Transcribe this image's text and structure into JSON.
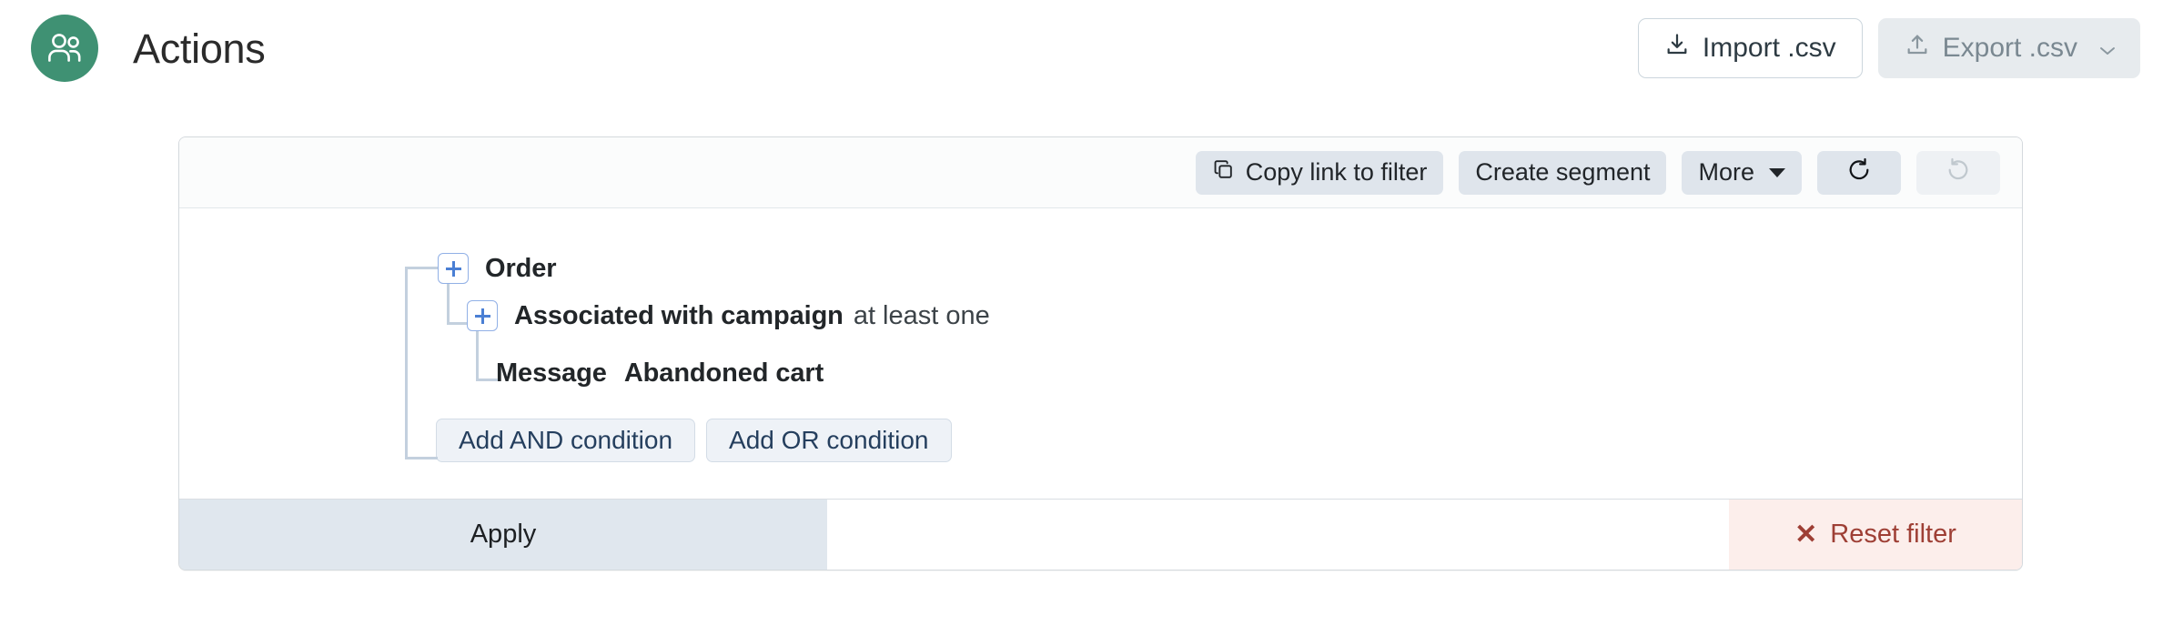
{
  "header": {
    "avatar_icon": "users-icon",
    "title": "Actions",
    "import_button": {
      "label": "Import .csv",
      "icon": "download-icon"
    },
    "export_button": {
      "label": "Export .csv",
      "icon": "upload-icon",
      "caret_icon": "chevron-down-icon",
      "disabled": true
    }
  },
  "filter_panel": {
    "toolbar": {
      "copy_link": {
        "label": "Copy link to filter",
        "icon": "copy-icon"
      },
      "create_segment": {
        "label": "Create segment"
      },
      "more": {
        "label": "More",
        "icon": "caret-down-icon"
      },
      "undo": {
        "icon": "undo-icon",
        "label": ""
      },
      "redo": {
        "icon": "redo-icon",
        "label": "",
        "disabled": true
      }
    },
    "conditions": {
      "order": {
        "expander_icon": "plus-box-icon",
        "label": "Order"
      },
      "campaign": {
        "expander_icon": "plus-box-icon",
        "label": "Associated with campaign",
        "operator": "at least one"
      },
      "message": {
        "label": "Message",
        "value": "Abandoned cart"
      }
    },
    "add_buttons": {
      "and": "Add AND condition",
      "or": "Add OR condition"
    },
    "footer": {
      "apply": "Apply",
      "reset": "Reset filter",
      "reset_icon": "close-x-icon"
    }
  },
  "colors": {
    "avatar_green": "#3f9173",
    "toolbar_button": "#dfe5ec",
    "apply_background": "#e0e7ee",
    "reset_background": "#fceeeb",
    "reset_text": "#9e3f35",
    "plus_blue": "#4a7fd4",
    "tree_line": "#c3d0de"
  }
}
